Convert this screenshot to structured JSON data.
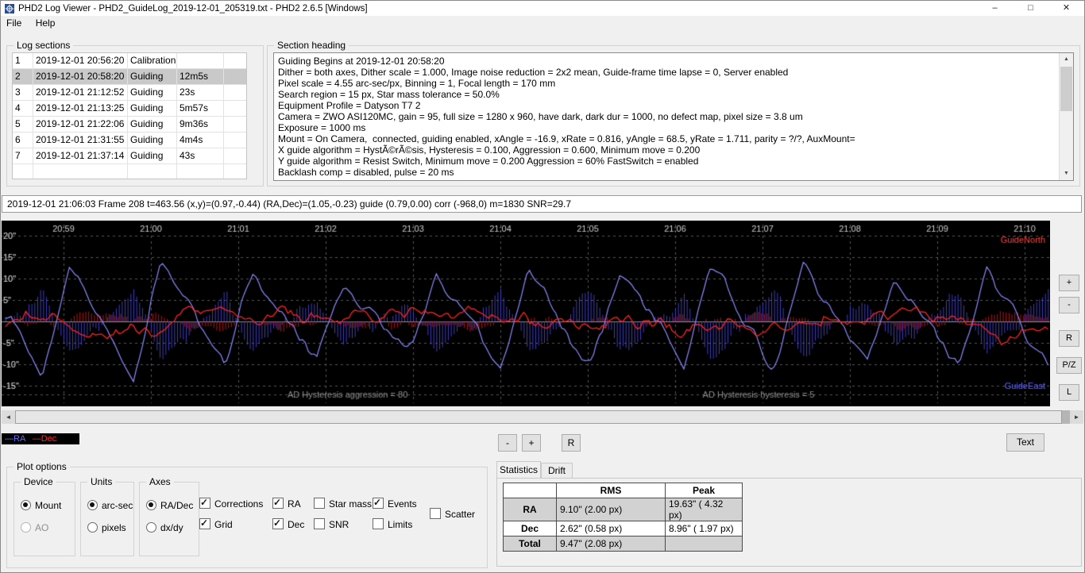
{
  "window": {
    "title": "PHD2 Log Viewer - PHD2_GuideLog_2019-12-01_205319.txt - PHD2 2.6.5 [Windows]",
    "controls": {
      "minimize": "–",
      "maximize": "□",
      "close": "✕"
    }
  },
  "menu": {
    "items": [
      {
        "label": "File"
      },
      {
        "label": "Help"
      }
    ]
  },
  "log_sections": {
    "title": "Log sections",
    "rows": [
      {
        "num": "1",
        "time": "2019-12-01 20:56:20",
        "type": "Calibration",
        "dur": ""
      },
      {
        "num": "2",
        "time": "2019-12-01 20:58:20",
        "type": "Guiding",
        "dur": "12m5s",
        "selected": true
      },
      {
        "num": "3",
        "time": "2019-12-01 21:12:52",
        "type": "Guiding",
        "dur": "23s"
      },
      {
        "num": "4",
        "time": "2019-12-01 21:13:25",
        "type": "Guiding",
        "dur": "5m57s"
      },
      {
        "num": "5",
        "time": "2019-12-01 21:22:06",
        "type": "Guiding",
        "dur": "9m36s"
      },
      {
        "num": "6",
        "time": "2019-12-01 21:31:55",
        "type": "Guiding",
        "dur": "4m4s"
      },
      {
        "num": "7",
        "time": "2019-12-01 21:37:14",
        "type": "Guiding",
        "dur": "43s"
      },
      {
        "num": "",
        "time": "",
        "type": "",
        "dur": ""
      }
    ]
  },
  "section_heading": {
    "title": "Section heading",
    "lines": [
      "Guiding Begins at 2019-12-01 20:58:20",
      "Dither = both axes, Dither scale = 1.000, Image noise reduction = 2x2 mean, Guide-frame time lapse = 0, Server enabled",
      "Pixel scale = 4.55 arc-sec/px, Binning = 1, Focal length = 170 mm",
      "Search region = 15 px, Star mass tolerance = 50.0%",
      "Equipment Profile = Datyson T7 2",
      "Camera = ZWO ASI120MC, gain = 95, full size = 1280 x 960, have dark, dark dur = 1000, no defect map, pixel size = 3.8 um",
      "Exposure = 1000 ms",
      "Mount = On Camera,  connected, guiding enabled, xAngle = -16.9, xRate = 0.816, yAngle = 68.5, yRate = 1.711, parity = ?/?, AuxMount=",
      "X guide algorithm = HystÃ©rÃ©sis, Hysteresis = 0.100, Aggression = 0.600, Minimum move = 0.200",
      "Y guide algorithm = Resist Switch, Minimum move = 0.200 Aggression = 60% FastSwitch = enabled",
      "Backlash comp = disabled, pulse = 20 ms"
    ]
  },
  "status_line": "2019-12-01 21:06:03 Frame 208 t=463.56 (x,y)=(0.97,-0.44) (RA,Dec)=(1.05,-0.23) guide (0.79,0.00) corr (-968,0) m=1830 SNR=29.7",
  "chart_data": {
    "type": "line",
    "x_ticks": [
      "20:59",
      "21:00",
      "21:01",
      "21:02",
      "21:03",
      "21:04",
      "21:05",
      "21:06",
      "21:07",
      "21:08",
      "21:09",
      "21:10"
    ],
    "y_ticks": [
      {
        "label": "20\"",
        "value": 20
      },
      {
        "label": "15\"",
        "value": 15
      },
      {
        "label": "10\"",
        "value": 10
      },
      {
        "label": "5\"",
        "value": 5
      },
      {
        "label": "-5\"",
        "value": -5
      },
      {
        "label": "-10\"",
        "value": -10
      },
      {
        "label": "-15\"",
        "value": -15
      }
    ],
    "ylim": [
      -18,
      22
    ],
    "units": "arc-sec",
    "duration_seconds": 716,
    "seconds_before_first_tick": 40,
    "legend": [
      "RA",
      "Dec"
    ],
    "series": [
      {
        "name": "RA",
        "color": "#8a8aff",
        "period_s": 63,
        "peak_arcsec": 15,
        "trough_arcsec": -14,
        "noise_arcsec": 2.5
      },
      {
        "name": "Dec",
        "color": "#ff2222",
        "typical_range_arcsec": 4,
        "noise_arcsec": 2
      }
    ],
    "corrections": {
      "ra_color": "#4444cc",
      "ra_max_arcsec": 10.5,
      "dec_color": "#cc1515",
      "dec_max_arcsec": 2.6
    },
    "annotations": [
      {
        "text": "AD Hysteresis aggression = 80",
        "x_frac": 0.33,
        "color": "#8f8f8f"
      },
      {
        "text": "AD Hysteresis hysteresis = 5",
        "x_frac": 0.722,
        "color": "#8f8f8f"
      }
    ],
    "corner_labels": {
      "top_right": {
        "text": "GuideNorth",
        "color": "#ff4040"
      },
      "bottom_right": {
        "text": "GuideEast",
        "color": "#6a6aff"
      }
    },
    "grid": true
  },
  "side_buttons": {
    "plus": "+",
    "minus": "-",
    "reset": "R",
    "pz": "P/Z",
    "l": "L"
  },
  "scrollbar": {
    "h_left": "◄",
    "h_right": "►",
    "v_up": "▲",
    "v_down": "▼"
  },
  "legend": {
    "sample": "—",
    "ra_label": "RA",
    "dec_label": "Dec",
    "ra_color": "#6a6aff",
    "dec_color": "#ff2a2a"
  },
  "toolbar": {
    "minus": "-",
    "plus": "+",
    "reset": "R",
    "text_button": "Text"
  },
  "plot_options": {
    "title": "Plot options",
    "device": {
      "title": "Device",
      "options": [
        {
          "label": "Mount",
          "selected": true
        },
        {
          "label": "AO",
          "selected": false,
          "disabled": true
        }
      ]
    },
    "units": {
      "title": "Units",
      "options": [
        {
          "label": "arc-sec",
          "selected": true
        },
        {
          "label": "pixels",
          "selected": false
        }
      ]
    },
    "axes": {
      "title": "Axes",
      "options": [
        {
          "label": "RA/Dec",
          "selected": true
        },
        {
          "label": "dx/dy",
          "selected": false
        }
      ]
    },
    "checkboxes": [
      {
        "label": "Corrections",
        "checked": true
      },
      {
        "label": "Grid",
        "checked": true
      },
      {
        "label": "RA",
        "checked": true
      },
      {
        "label": "Dec",
        "checked": true
      },
      {
        "label": "Star mass",
        "checked": false
      },
      {
        "label": "SNR",
        "checked": false
      },
      {
        "label": "Events",
        "checked": true
      },
      {
        "label": "Limits",
        "checked": false
      },
      {
        "label": "Scatter",
        "checked": false
      }
    ]
  },
  "statistics": {
    "tabs": [
      {
        "label": "Statistics",
        "active": true
      },
      {
        "label": "Drift",
        "active": false
      }
    ],
    "table": {
      "headers": [
        "",
        "RMS",
        "Peak"
      ],
      "rows": [
        {
          "label": "RA",
          "rms": "9.10\" (2.00 px)",
          "peak": "19.63\" ( 4.32 px)"
        },
        {
          "label": "Dec",
          "rms": "2.62\" (0.58 px)",
          "peak": "8.96\" ( 1.97 px)"
        },
        {
          "label": "Total",
          "rms": "9.47\" (2.08 px)",
          "peak": ""
        }
      ]
    }
  }
}
